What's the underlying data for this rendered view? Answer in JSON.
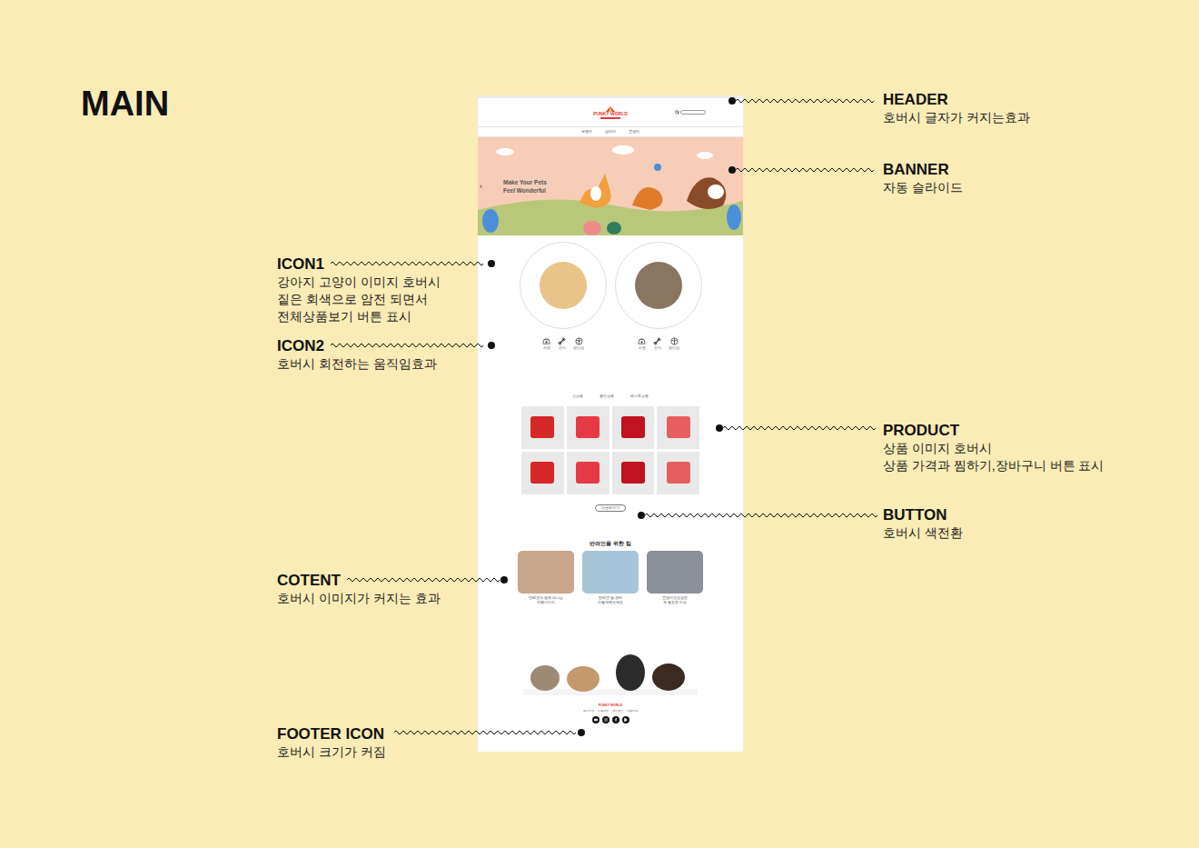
{
  "slide": {
    "title": "MAIN"
  },
  "annotations": [
    {
      "label": "HEADER",
      "description": [
        "호버시 글자가 커지는효과"
      ]
    },
    {
      "label": "BANNER",
      "description": [
        "자동 슬라이드"
      ]
    },
    {
      "label": "ICON1",
      "description": [
        "강아지 고양이 이미지 호버시",
        "짙은 회색으로 암전 되면서",
        "전체상품보기 버튼 표시"
      ]
    },
    {
      "label": "ICON2",
      "description": [
        "호버시 회전하는 움직임효과"
      ]
    },
    {
      "label": "PRODUCT",
      "description": [
        "상품 이미지 호버시",
        "상품 가격과 찜하기,장바구니 버튼 표시"
      ]
    },
    {
      "label": "BUTTON",
      "description": [
        "호버시 색전환"
      ]
    },
    {
      "label": "COTENT",
      "description": [
        "호버시 이미지가 커지는 효과"
      ]
    },
    {
      "label": "FOOTER ICON",
      "description": [
        "호버시 크기가 커짐"
      ]
    }
  ],
  "mockup": {
    "logo": "PUNKY WORLD",
    "nav": [
      "브랜드",
      "강아지",
      "고양이"
    ],
    "banner": {
      "arrow": "‹",
      "headline": [
        "Make Your Pets",
        "Feel Wonderful"
      ]
    },
    "pets": [
      {
        "kind": "dog",
        "categories": [
          "사료",
          "간식",
          "장난감"
        ]
      },
      {
        "kind": "cat",
        "categories": [
          "사료",
          "간식",
          "장난감"
        ]
      }
    ],
    "product_tabs": [
      "신상품",
      "할인상품",
      "베스트상품"
    ],
    "more_button": "더 보러가기",
    "tips": {
      "title": "반려인을 위한 팁",
      "cards": [
        {
          "caption": [
            "반려견과 함께 떠나는",
            "여행 가이드"
          ]
        },
        {
          "caption": [
            "반려견 털 관리",
            "이렇게 해보세요"
          ]
        },
        {
          "caption": [
            "고양이 건강검진",
            "꼭 필요한 이유"
          ]
        }
      ]
    },
    "footer": {
      "logo": "PUNKY WORLD",
      "links": [
        "회사소개",
        "이용약관",
        "개인정보",
        "이용안내"
      ]
    }
  }
}
